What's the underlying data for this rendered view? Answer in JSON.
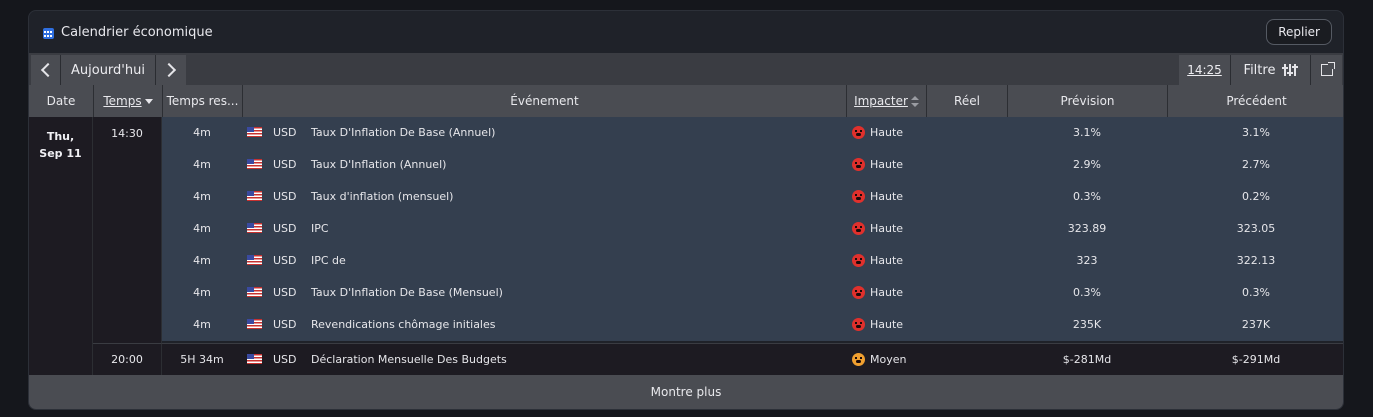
{
  "header": {
    "title": "Calendrier économique",
    "collapse_label": "Replier"
  },
  "toolbar": {
    "today_label": "Aujourd'hui",
    "current_time": "14:25",
    "filter_label": "Filtre"
  },
  "columns": {
    "date": "Date",
    "time": "Temps",
    "remaining": "Temps res...",
    "event": "Événement",
    "impact": "Impacter",
    "actual": "Réel",
    "forecast": "Prévision",
    "previous": "Précédent"
  },
  "date_group": {
    "line1": "Thu,",
    "line2": "Sep 11"
  },
  "time_groups": [
    {
      "time": "14:30"
    },
    {
      "time": "20:00"
    }
  ],
  "rows": [
    {
      "remaining": "4m",
      "currency": "USD",
      "event": "Taux D'Inflation De Base (Annuel)",
      "impact": "Haute",
      "impact_level": "high",
      "actual": "",
      "forecast": "3.1%",
      "previous": "3.1%"
    },
    {
      "remaining": "4m",
      "currency": "USD",
      "event": "Taux D'Inflation (Annuel)",
      "impact": "Haute",
      "impact_level": "high",
      "actual": "",
      "forecast": "2.9%",
      "previous": "2.7%"
    },
    {
      "remaining": "4m",
      "currency": "USD",
      "event": "Taux d'inflation (mensuel)",
      "impact": "Haute",
      "impact_level": "high",
      "actual": "",
      "forecast": "0.3%",
      "previous": "0.2%"
    },
    {
      "remaining": "4m",
      "currency": "USD",
      "event": "IPC",
      "impact": "Haute",
      "impact_level": "high",
      "actual": "",
      "forecast": "323.89",
      "previous": "323.05"
    },
    {
      "remaining": "4m",
      "currency": "USD",
      "event": "IPC de",
      "impact": "Haute",
      "impact_level": "high",
      "actual": "",
      "forecast": "323",
      "previous": "322.13"
    },
    {
      "remaining": "4m",
      "currency": "USD",
      "event": "Taux D'Inflation De Base (Mensuel)",
      "impact": "Haute",
      "impact_level": "high",
      "actual": "",
      "forecast": "0.3%",
      "previous": "0.3%"
    },
    {
      "remaining": "4m",
      "currency": "USD",
      "event": "Revendications chômage initiales",
      "impact": "Haute",
      "impact_level": "high",
      "actual": "",
      "forecast": "235K",
      "previous": "237K"
    },
    {
      "remaining": "5H 34m",
      "currency": "USD",
      "event": "Déclaration Mensuelle Des Budgets",
      "impact": "Moyen",
      "impact_level": "medium",
      "actual": "",
      "forecast": "$-281Md",
      "previous": "$-291Md"
    }
  ],
  "footer": {
    "show_more_label": "Montre plus"
  },
  "icons": {
    "calendar": "calendar-icon",
    "prev": "chevron-left-icon",
    "next": "chevron-right-icon",
    "filter": "sliders-icon",
    "external": "external-link-icon",
    "flag": "us-flag-icon",
    "impact_high": "angry-face-icon",
    "impact_medium": "neutral-face-icon"
  },
  "colors": {
    "highlight_row": "#343f4f",
    "impact_high": "#e0302c",
    "impact_medium": "#f0a030",
    "calendar_icon": "#2f6fe0"
  }
}
